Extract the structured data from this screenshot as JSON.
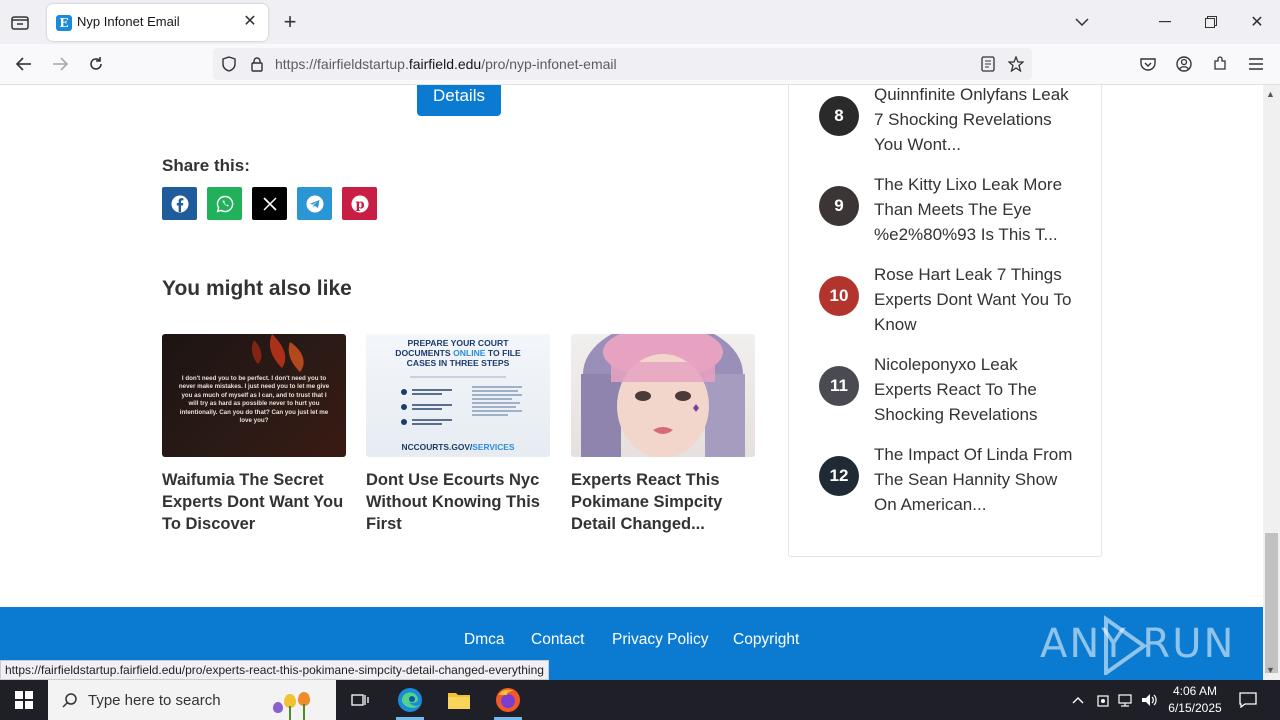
{
  "browser": {
    "tab_title": "Nyp Infonet Email",
    "tab_favicon": "E",
    "url_prefix": "https://fairfieldstartup.",
    "url_domain": "fairfield.edu",
    "url_suffix": "/pro/nyp-infonet-email",
    "status_url": "https://fairfieldstartup.fairfield.edu/pro/experts-react-this-pokimane-simpcity-detail-changed-everything"
  },
  "page": {
    "details_label": "Details",
    "share_title": "Share this:",
    "share_buttons": [
      {
        "name": "facebook",
        "color": "#1e5c9b"
      },
      {
        "name": "whatsapp",
        "color": "#22b15b"
      },
      {
        "name": "x",
        "color": "#000000"
      },
      {
        "name": "telegram",
        "color": "#2a97d4"
      },
      {
        "name": "pinterest",
        "color": "#c81e45"
      }
    ],
    "also_title": "You might also like",
    "cards": [
      {
        "title": "Waifumia The Secret Experts Dont Want You To Discover",
        "image_text": "I don't need you to be perfect. I don't need you to never make mistakes. I just need you to let me give you as much of myself as I can, and to trust that I will try as hard as possible never to hurt you intentionally. Can you do that? Can you just let me love you?"
      },
      {
        "title": "Dont Use Ecourts Nyc Without Knowing This First",
        "image_heading_1": "PREPARE YOUR COURT",
        "image_heading_2": "DOCUMENTS",
        "image_heading_accent": "ONLINE",
        "image_heading_3": "TO FILE",
        "image_heading_4": "CASES IN THREE STEPS",
        "image_footer": "NCCOURTS.GOV/",
        "image_footer_accent": "SERVICES"
      },
      {
        "title": "Experts React This Pokimane Simpcity Detail Changed..."
      }
    ]
  },
  "sidebar": {
    "items": [
      {
        "rank": "8",
        "text": "Quinnfinite Onlyfans Leak 7 Shocking Revelations You Wont..."
      },
      {
        "rank": "9",
        "text": "The Kitty Lixo Leak More Than Meets The Eye %e2%80%93 Is This T..."
      },
      {
        "rank": "10",
        "text": "Rose Hart Leak 7 Things Experts Dont Want You To Know"
      },
      {
        "rank": "11",
        "text": "Nicoleponyxo Leak Experts React To The Shocking Revelations"
      },
      {
        "rank": "12",
        "text": "The Impact Of Linda From The Sean Hannity Show On American..."
      }
    ]
  },
  "footer": {
    "links": [
      "Dmca",
      "Contact",
      "Privacy Policy",
      "Copyright"
    ],
    "watermark": "ANY RUN"
  },
  "taskbar": {
    "search_placeholder": "Type here to search",
    "time": "4:06 AM",
    "date": "6/15/2025"
  },
  "colors": {
    "accent": "#0a7bd0",
    "taskbar": "#1f1f27"
  }
}
